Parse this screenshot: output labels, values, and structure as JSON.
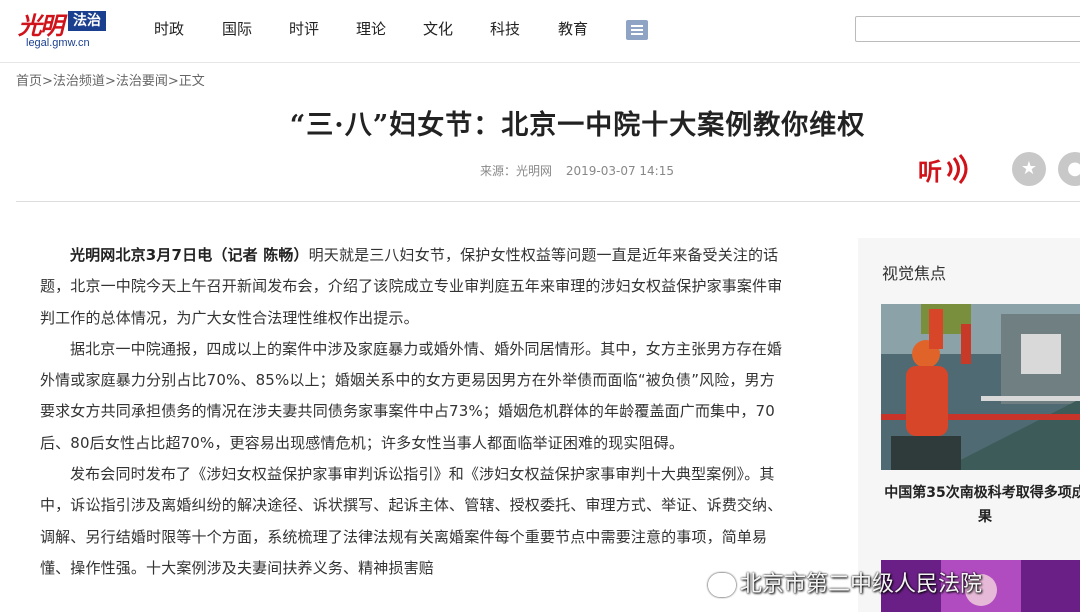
{
  "header": {
    "logo_mark": "光明",
    "logo_badge": "法治",
    "logo_domain": "legal.gmw.cn",
    "nav": [
      "时政",
      "国际",
      "时评",
      "理论",
      "文化",
      "科技",
      "教育"
    ],
    "search_placeholder": ""
  },
  "breadcrumb": {
    "items": [
      "首页",
      "法治频道",
      "法治要闻",
      "正文"
    ],
    "separator": ">"
  },
  "article": {
    "title": "“三·八”妇女节：北京一中院十大案例教你维权",
    "source": "来源：光明网",
    "datetime": "2019-03-07 14:15",
    "listen_label": "听",
    "lead": "光明网北京3月7日电（记者 陈畅）",
    "p1": "明天就是三八妇女节，保护女性权益等问题一直是近年来备受关注的话题，北京一中院今天上午召开新闻发布会，介绍了该院成立专业审判庭五年来审理的涉妇女权益保护家事案件审判工作的总体情况，为广大女性合法理性维权作出提示。",
    "p2": "据北京一中院通报，四成以上的案件中涉及家庭暴力或婚外情、婚外同居情形。其中，女方主张男方存在婚外情或家庭暴力分别占比70%、85%以上；婚姻关系中的女方更易因男方在外举债而面临“被负债”风险，男方要求女方共同承担债务的情况在涉夫妻共同债务家事案件中占73%；婚姻危机群体的年龄覆盖面广而集中，70后、80后女性占比超70%，更容易出现感情危机；许多女性当事人都面临举证困难的现实阻碍。",
    "p3": "发布会同时发布了《涉妇女权益保护家事审判诉讼指引》和《涉妇女权益保护家事审判十大典型案例》。其中，诉讼指引涉及离婚纠纷的解决途径、诉状撰写、起诉主体、管辖、授权委托、审理方式、举证、诉费交纳、调解、另行结婚时限等十个方面，系统梳理了法律法规有关离婚案件每个重要节点中需要注意的事项，简单易懂、操作性强。十大案例涉及夫妻间扶养义务、精神损害赔"
  },
  "sidebar": {
    "title": "视觉焦点",
    "caption": "中国第35次南极科考取得多项成果"
  },
  "watermark": "北京市第二中级人民法院",
  "colors": {
    "brand_red": "#d0121b",
    "brand_blue": "#1b3f8f",
    "sidebar_bg": "#f6f6f6"
  },
  "icons": [
    "menu-icon",
    "listen-icon",
    "star-icon",
    "wechat-icon"
  ]
}
